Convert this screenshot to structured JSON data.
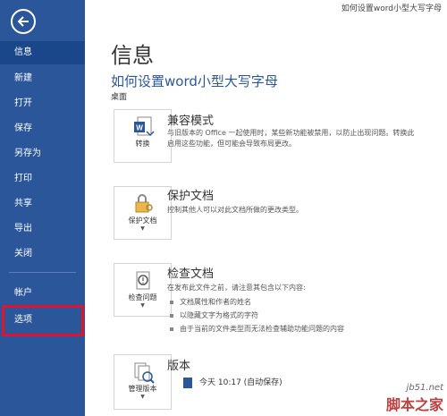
{
  "window": {
    "title": "如何设置word小型大写字母"
  },
  "sidebar": {
    "back_icon": "back-arrow-icon",
    "items": [
      {
        "label": "信息",
        "active": true
      },
      {
        "label": "新建"
      },
      {
        "label": "打开"
      },
      {
        "label": "保存"
      },
      {
        "label": "另存为"
      },
      {
        "label": "打印"
      },
      {
        "label": "共享"
      },
      {
        "label": "导出"
      },
      {
        "label": "关闭"
      },
      {
        "label": "帐户"
      },
      {
        "label": "选项",
        "highlighted": true
      }
    ]
  },
  "main": {
    "page_title": "信息",
    "doc_title": "如何设置word小型大写字母",
    "doc_location": "桌面",
    "sections": [
      {
        "button_label": "转换",
        "icon": "convert-word-icon",
        "heading": "兼容模式",
        "text": "与旧版本的 Office 一起使用时，某些新功能被禁用，以防止出现问题。转换此\n启用这些功能，但可能会导致布局更改。"
      },
      {
        "button_label": "保护文档",
        "icon": "lock-key-icon",
        "heading": "保护文档",
        "text": "控制其他人可以对此文档所做的更改类型。"
      },
      {
        "button_label": "检查问题",
        "icon": "inspect-document-icon",
        "heading": "检查文档",
        "text": "在发布此文件之前，请注意其包含以下内容:",
        "bullets": [
          "文档属性和作者的姓名",
          "以隐藏文字为格式的字符",
          "由于当前的文件类型而无法检查辅助功能问题的内容"
        ]
      },
      {
        "button_label": "管理版本",
        "icon": "manage-versions-icon",
        "heading": "版本",
        "version_entry": "今天 10:17 (自动保存)"
      }
    ]
  },
  "watermark": {
    "site": "jb51.net",
    "name": "脚本之家"
  },
  "colors": {
    "sidebar": "#2b579a",
    "highlight": "#e0142b",
    "title_blue": "#2b579a"
  }
}
